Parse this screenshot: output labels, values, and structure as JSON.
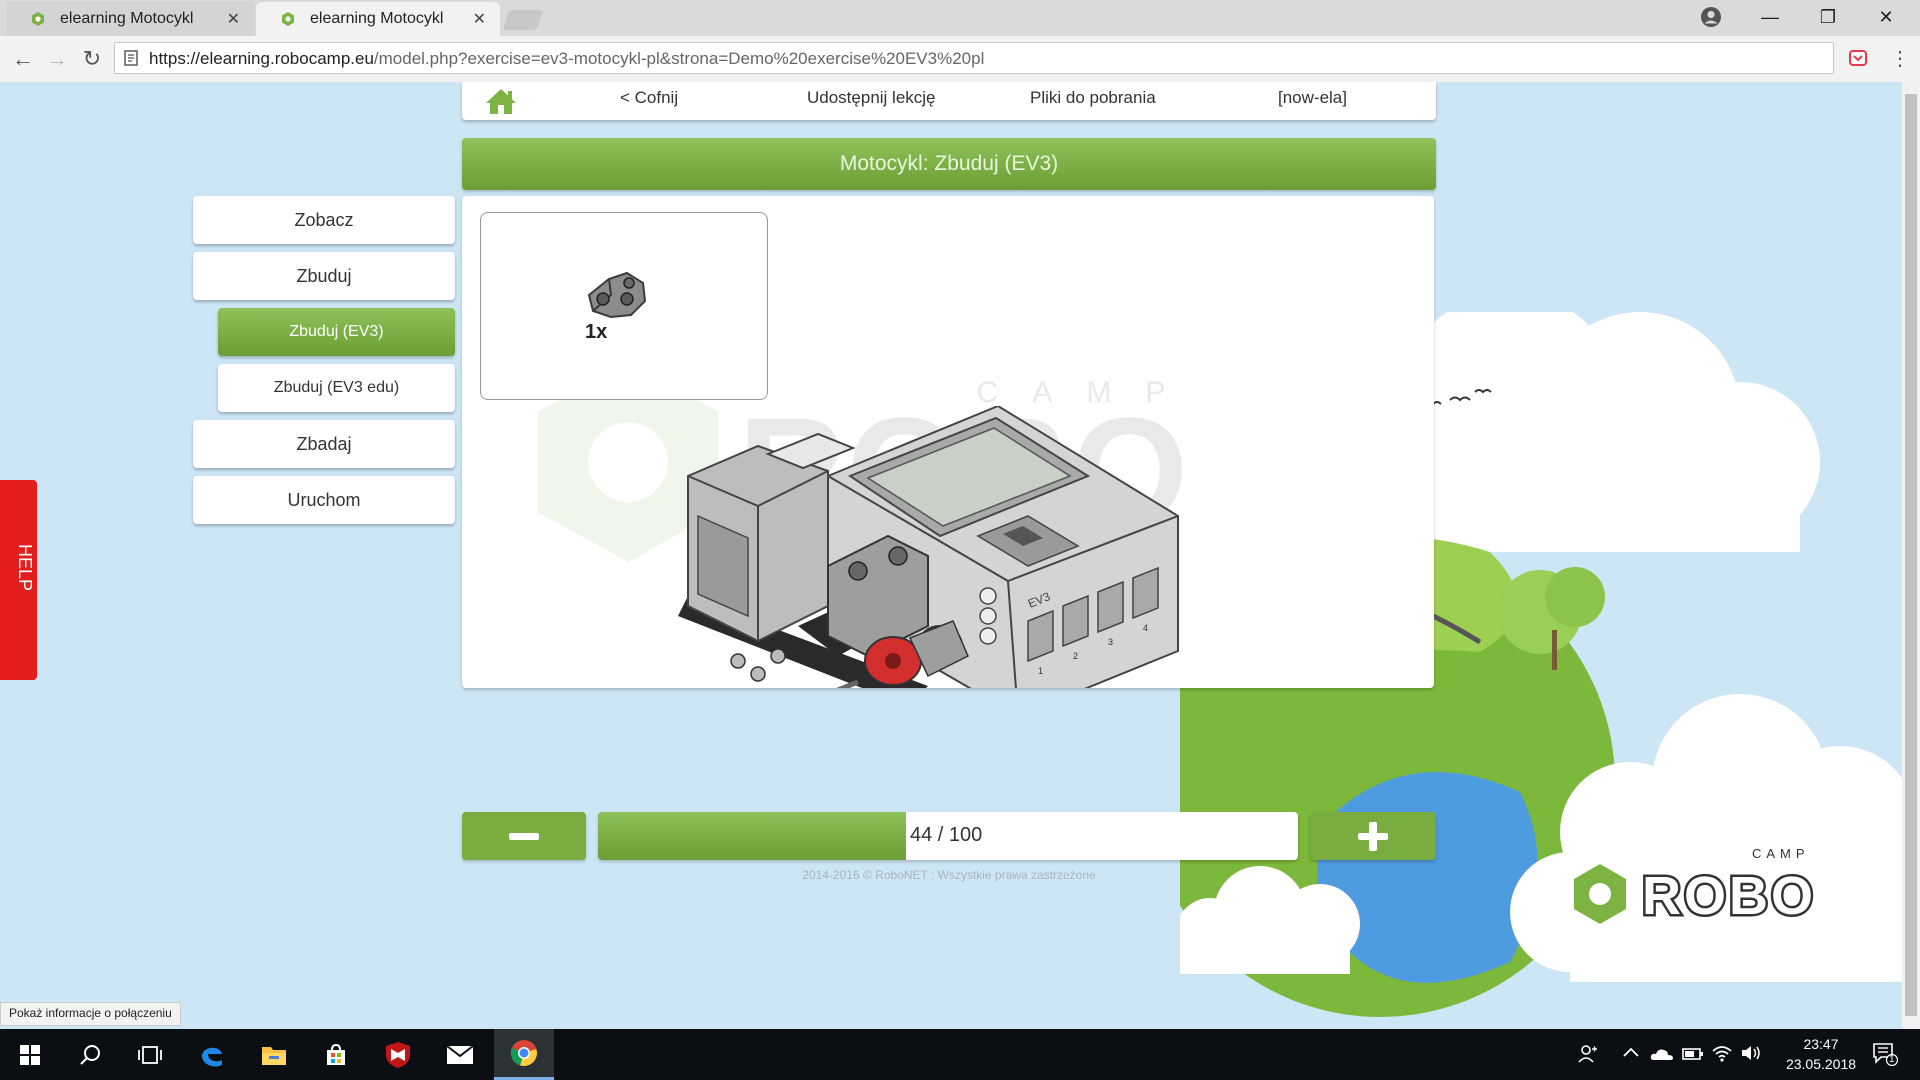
{
  "browser": {
    "tabs": [
      {
        "title": "elearning Motocykl",
        "active": false
      },
      {
        "title": "elearning Motocykl",
        "active": true
      }
    ],
    "close_glyph": "✕",
    "window_controls": {
      "minimize": "—",
      "restore": "❐",
      "close": "✕"
    },
    "url_host": "https://elearning.robocamp.eu",
    "url_path": "/model.php?exercise=ev3-motocykl-pl&strona=Demo%20exercise%20EV3%20pl",
    "status_tooltip": "Pokaż informacje o połączeniu"
  },
  "topnav": {
    "back": "< Cofnij",
    "share": "Udostępnij lekcję",
    "downloads": "Pliki do pobrania",
    "user": "[now-ela]"
  },
  "banner_title": "Motocykl: Zbuduj (EV3)",
  "sidebar": {
    "items": [
      {
        "label": "Zobacz"
      },
      {
        "label": "Zbuduj"
      },
      {
        "label": "Zbuduj (EV3)",
        "active": true
      },
      {
        "label": "Zbuduj (EV3 edu)"
      },
      {
        "label": "Zbadaj"
      },
      {
        "label": "Uruchom"
      }
    ]
  },
  "help_label": "HELP",
  "parts": {
    "count": "1x"
  },
  "progress": {
    "current": 44,
    "total": 100,
    "label": "44 / 100",
    "fraction": 0.44
  },
  "footer": "2014-2016 © RoboNET : Wszystkie prawa zastrzeżone",
  "logo": {
    "camp": "CAMP",
    "robo": "ROBO"
  },
  "brick_label": "EV3",
  "port_labels": [
    "1",
    "2",
    "3",
    "4"
  ],
  "colors": {
    "accent_green": "#7cb342",
    "help_red": "#e41e1e",
    "sky": "#cde6f6"
  },
  "taskbar": {
    "time": "23:47",
    "date": "23.05.2018",
    "notification_count": "1"
  }
}
